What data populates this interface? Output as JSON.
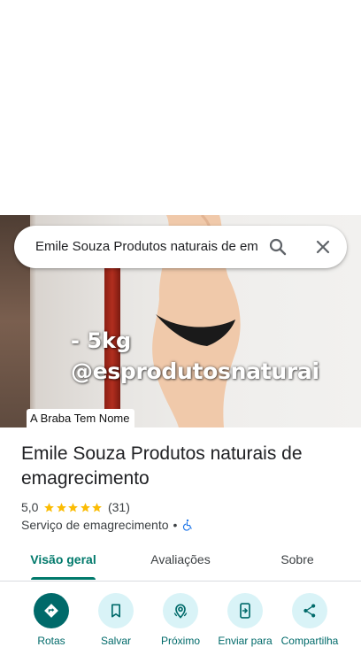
{
  "search": {
    "query": "Emile Souza Produtos naturais de em"
  },
  "photo": {
    "caption_line1": "- 5kg",
    "caption_line2": "@esprodutosnaturai",
    "tag": "A Braba Tem Nome"
  },
  "place": {
    "title": "Emile Souza Produtos naturais de emagrecimento",
    "rating": "5,0",
    "stars": 5,
    "review_count": "(31)",
    "category": "Serviço de emagrecimento",
    "separator": "•"
  },
  "tabs": [
    {
      "label": "Visão geral",
      "active": true
    },
    {
      "label": "Avaliações",
      "active": false
    },
    {
      "label": "Sobre",
      "active": false
    }
  ],
  "actions": [
    {
      "label": "Rotas",
      "icon": "directions-icon"
    },
    {
      "label": "Salvar",
      "icon": "bookmark-icon"
    },
    {
      "label": "Próximo",
      "icon": "nearby-icon"
    },
    {
      "label": "Enviar para",
      "icon": "send-to-phone-icon"
    },
    {
      "label": "Compartilha",
      "icon": "share-icon"
    }
  ],
  "colors": {
    "accent": "#00796b",
    "action_bg": "#d9f3f7",
    "primary_action": "#006a6a",
    "star": "#fbbc04"
  }
}
